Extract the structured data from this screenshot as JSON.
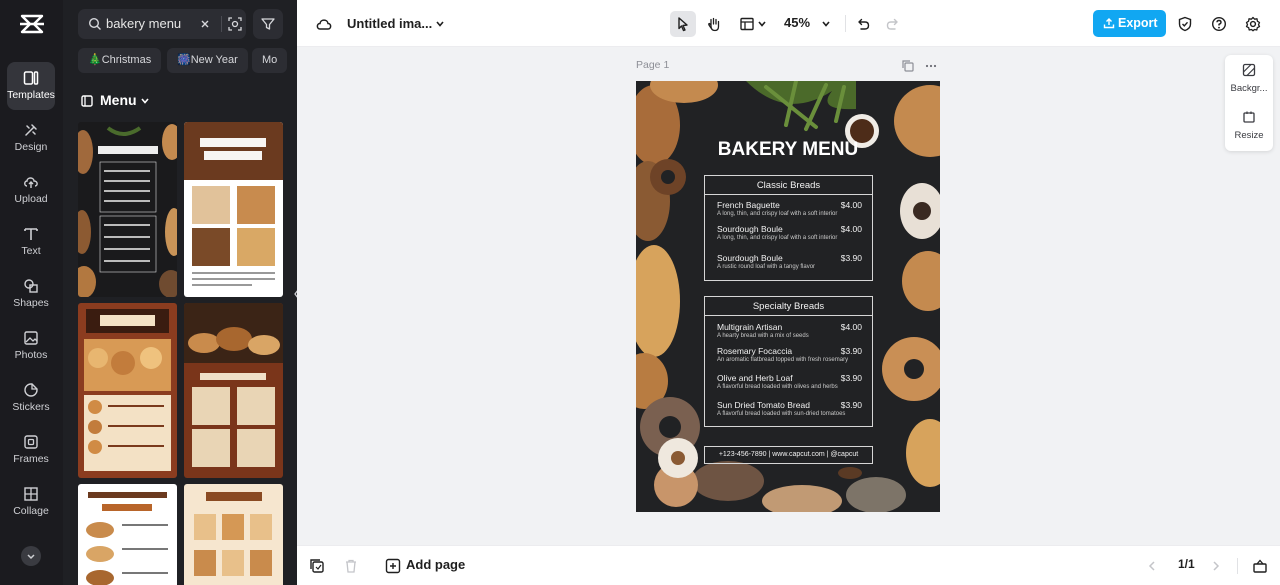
{
  "app": {
    "name": "CapCut"
  },
  "rail": {
    "items": [
      {
        "label": "Templates",
        "icon": "templates-icon",
        "active": true
      },
      {
        "label": "Design",
        "icon": "design-icon"
      },
      {
        "label": "Upload",
        "icon": "upload-icon"
      },
      {
        "label": "Text",
        "icon": "text-icon"
      },
      {
        "label": "Shapes",
        "icon": "shapes-icon"
      },
      {
        "label": "Photos",
        "icon": "photos-icon"
      },
      {
        "label": "Stickers",
        "icon": "stickers-icon"
      },
      {
        "label": "Frames",
        "icon": "frames-icon"
      },
      {
        "label": "Collage",
        "icon": "collage-icon"
      }
    ]
  },
  "panel": {
    "search": {
      "value": "bakery menu"
    },
    "chips": [
      "🎄Christmas",
      "🎆New Year",
      "Mo"
    ],
    "section_title": "Menu",
    "templates": [
      {
        "title": "BAKERY MENU",
        "style": "dark"
      },
      {
        "title": "The Art Of Baking",
        "style": "brown-white"
      },
      {
        "title": "BAKERY",
        "style": "brown"
      },
      {
        "title": "BEST SELLERS",
        "style": "brown-photo"
      },
      {
        "title": "SPECIAL BAKERY MENU",
        "style": "white"
      },
      {
        "title": "Bakery Menu",
        "style": "cream"
      }
    ]
  },
  "topbar": {
    "project_name": "Untitled ima...",
    "zoom": "45%",
    "export_label": "Export"
  },
  "canvas": {
    "page_label": "Page 1",
    "design": {
      "title": "BAKERY MENU",
      "sections": [
        {
          "heading": "Classic Breads",
          "items": [
            {
              "name": "French Baguette",
              "price": "$4.00",
              "desc": "A long, thin, and crispy loaf with a soft interior"
            },
            {
              "name": "Sourdough Boule",
              "price": "$4.00",
              "desc": "A long, thin, and crispy loaf with a soft interior"
            },
            {
              "name": "Sourdough Boule",
              "price": "$3.90",
              "desc": "A rustic round loaf with a tangy flavor"
            }
          ]
        },
        {
          "heading": "Specialty Breads",
          "items": [
            {
              "name": "Multigrain Artisan",
              "price": "$4.00",
              "desc": "A hearty bread with a mix of seeds"
            },
            {
              "name": "Rosemary Focaccia",
              "price": "$3.90",
              "desc": "An aromatic flatbread topped with fresh rosemary"
            },
            {
              "name": "Olive and Herb Loaf",
              "price": "$3.90",
              "desc": "A flavorful bread loaded with olives and herbs"
            },
            {
              "name": "Sun Dried Tomato Bread",
              "price": "$3.90",
              "desc": "A flavorful bread loaded with sun-dried tomatoes"
            }
          ]
        }
      ],
      "contact": "+123-456-7890 | www.capcut.com | @capcut"
    }
  },
  "right_tools": [
    {
      "label": "Backgr...",
      "icon": "background-icon"
    },
    {
      "label": "Resize",
      "icon": "resize-icon"
    }
  ],
  "bottombar": {
    "add_page": "Add page",
    "pager": "1/1"
  },
  "colors": {
    "accent": "#11a7f2",
    "rail_bg": "#1b1b1f",
    "panel_bg": "#1f2024"
  }
}
